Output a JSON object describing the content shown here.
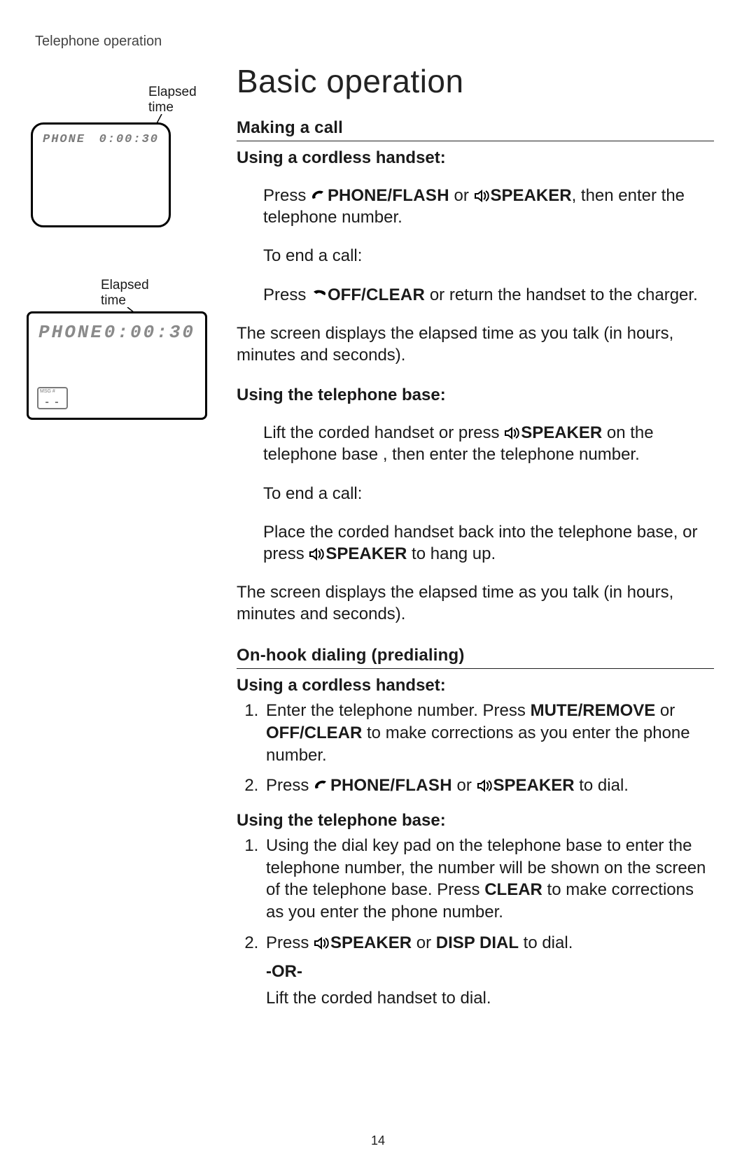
{
  "breadcrumb": "Telephone operation",
  "title": "Basic operation",
  "pagenum": "14",
  "illus1": {
    "label": "Elapsed\ntime",
    "screen_left": "PHONE",
    "screen_right": "0:00:30"
  },
  "illus2": {
    "label": "Elapsed\ntime",
    "screen_left": "PHONE",
    "screen_right": "0:00:30",
    "msg_tag": "MSG #",
    "msg_val": "- -"
  },
  "s1": {
    "hd": "Making a call",
    "sub1": "Using a cordless handset:",
    "p1a": "Press ",
    "p1b_phone": "PHONE",
    "p1b_flash": "/FLASH",
    "p1c": " or ",
    "p1d_speaker": "SPEAKER",
    "p1e": ", then enter the telephone number.",
    "p2": "To end a call:",
    "p3a": "Press ",
    "p3b_off": "OFF",
    "p3b_clear": "/CLEAR",
    "p3c": " or return the handset to the charger.",
    "p4": "The screen displays the elapsed time as you talk (in hours, minutes and seconds).",
    "sub2": "Using the telephone base:",
    "p5a": "Lift the corded handset or press ",
    "p5b_speaker": "SPEAKER",
    "p5c": " on the telephone base , then enter the telephone number.",
    "p6": "To end a call:",
    "p7a": "Place the corded handset back into the telephone base, or press ",
    "p7b_speaker": "SPEAKER",
    "p7c": " to hang up.",
    "p8": "The screen displays the elapsed time as you talk (in hours, minutes and seconds)."
  },
  "s2": {
    "hd": "On-hook dialing (predialing)",
    "sub1": "Using a cordless handset:",
    "li1a": "Enter the telephone number. Press ",
    "li1b_mute": "MUTE",
    "li1b_remove": "/REMOVE",
    "li1c": " or ",
    "li1d_off": "OFF",
    "li1d_clear": "/CLEAR",
    "li1e": " to make corrections as you enter the phone number.",
    "li2a": "Press ",
    "li2b_phone": "PHONE",
    "li2b_flash": "/FLASH",
    "li2c": " or ",
    "li2d_speaker": "SPEAKER",
    "li2e": " to dial.",
    "sub2": "Using the telephone base:",
    "li3": "Using the dial key pad on the telephone base to enter the telephone number, the number will be shown on the screen of the telephone base. Press ",
    "li3b_clear": "CLEAR",
    "li3c": " to make corrections as you enter the phone number.",
    "li4a": "Press ",
    "li4b_speaker": "SPEAKER",
    "li4c": " or ",
    "li4d_disp": "DISP DIAL",
    "li4e": " to dial.",
    "or": "-OR-",
    "li5": "Lift the corded handset to dial."
  }
}
